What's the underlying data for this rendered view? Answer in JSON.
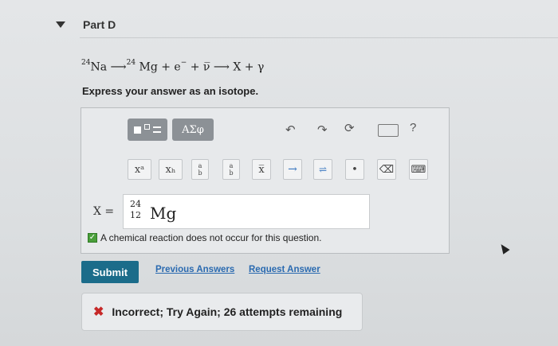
{
  "part": {
    "title": "Part D"
  },
  "equation": {
    "reactant_mass": "24",
    "reactant_symbol": "Na",
    "product_mass": "24",
    "product_rest": "Mg + e",
    "tail": "+ ν̅ ⟶ X + γ",
    "electron_charge": "−"
  },
  "instruction": "Express your answer as an isotope.",
  "toolbar": {
    "greek_label": "ΑΣφ",
    "help_label": "?",
    "symbols": {
      "sup": "xᵃ",
      "sub": "xₕ",
      "frac_top": "a",
      "frac_bottom": "b",
      "bar": "x̅",
      "arrow": "→",
      "equilibrium": "⇌",
      "dot": "•"
    }
  },
  "answer": {
    "variable_label": "X =",
    "mass_number": "24",
    "atomic_number": "12",
    "element": "Mg"
  },
  "no_reaction_checkbox": {
    "checked": true,
    "label": "A chemical reaction does not occur for this question."
  },
  "buttons": {
    "submit": "Submit",
    "previous_answers": "Previous Answers",
    "request_answer": "Request Answer"
  },
  "feedback": {
    "icon": "✖",
    "message": "Incorrect; Try Again; 26 attempts remaining",
    "color": "#c62828"
  },
  "colors": {
    "submit_bg": "#1b6c8a",
    "link": "#2a6ab0",
    "check": "#4a9e3a"
  }
}
